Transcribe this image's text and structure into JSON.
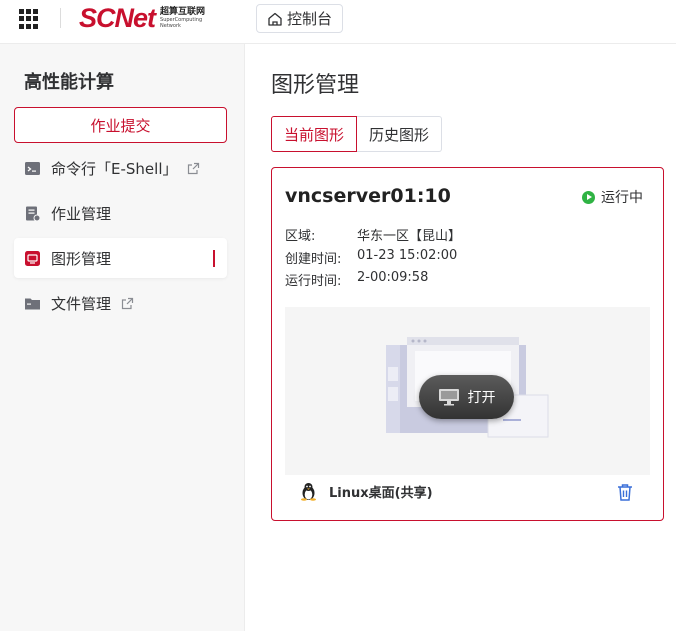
{
  "header": {
    "logo_main": "SCNet",
    "logo_sub_cn": "超算互联网",
    "logo_sub_en_1": "SuperComputing",
    "logo_sub_en_2": "Network",
    "console_label": "控制台"
  },
  "sidebar": {
    "title": "高性能计算",
    "submit_label": "作业提交",
    "items": [
      {
        "label": "命令行「E-Shell」",
        "external": true
      },
      {
        "label": "作业管理",
        "external": false
      },
      {
        "label": "图形管理",
        "external": false,
        "active": true
      },
      {
        "label": "文件管理",
        "external": true
      }
    ]
  },
  "main": {
    "title": "图形管理",
    "tabs": [
      {
        "label": "当前图形",
        "active": true
      },
      {
        "label": "历史图形",
        "active": false
      }
    ],
    "card": {
      "name": "vncserver01:10",
      "status": "运行中",
      "region_key": "区域:",
      "region_value": "华东一区【昆山】",
      "created_key": "创建时间:",
      "created_value": "01-23 15:02:00",
      "runtime_key": "运行时间:",
      "runtime_value": "2-00:09:58",
      "open_label": "打开",
      "os_label": "Linux桌面(共享)"
    }
  },
  "colors": {
    "brand": "#c8102e",
    "running": "#2fb344",
    "trash": "#3a6fd8"
  }
}
